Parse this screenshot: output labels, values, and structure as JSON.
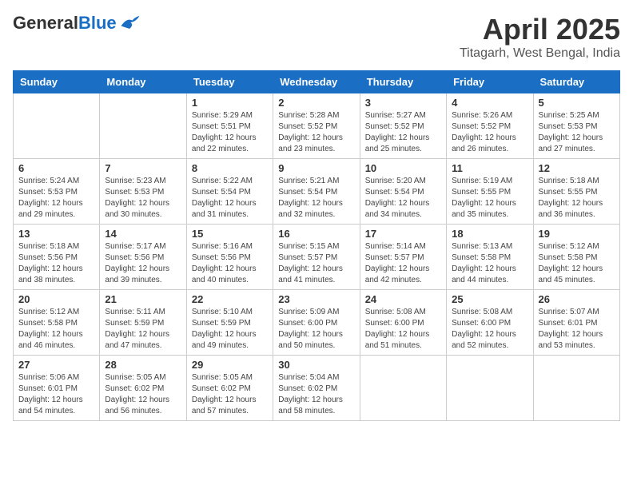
{
  "header": {
    "logo_general": "General",
    "logo_blue": "Blue",
    "title": "April 2025",
    "subtitle": "Titagarh, West Bengal, India"
  },
  "weekdays": [
    "Sunday",
    "Monday",
    "Tuesday",
    "Wednesday",
    "Thursday",
    "Friday",
    "Saturday"
  ],
  "weeks": [
    [
      {
        "day": "",
        "info": ""
      },
      {
        "day": "",
        "info": ""
      },
      {
        "day": "1",
        "info": "Sunrise: 5:29 AM\nSunset: 5:51 PM\nDaylight: 12 hours and 22 minutes."
      },
      {
        "day": "2",
        "info": "Sunrise: 5:28 AM\nSunset: 5:52 PM\nDaylight: 12 hours and 23 minutes."
      },
      {
        "day": "3",
        "info": "Sunrise: 5:27 AM\nSunset: 5:52 PM\nDaylight: 12 hours and 25 minutes."
      },
      {
        "day": "4",
        "info": "Sunrise: 5:26 AM\nSunset: 5:52 PM\nDaylight: 12 hours and 26 minutes."
      },
      {
        "day": "5",
        "info": "Sunrise: 5:25 AM\nSunset: 5:53 PM\nDaylight: 12 hours and 27 minutes."
      }
    ],
    [
      {
        "day": "6",
        "info": "Sunrise: 5:24 AM\nSunset: 5:53 PM\nDaylight: 12 hours and 29 minutes."
      },
      {
        "day": "7",
        "info": "Sunrise: 5:23 AM\nSunset: 5:53 PM\nDaylight: 12 hours and 30 minutes."
      },
      {
        "day": "8",
        "info": "Sunrise: 5:22 AM\nSunset: 5:54 PM\nDaylight: 12 hours and 31 minutes."
      },
      {
        "day": "9",
        "info": "Sunrise: 5:21 AM\nSunset: 5:54 PM\nDaylight: 12 hours and 32 minutes."
      },
      {
        "day": "10",
        "info": "Sunrise: 5:20 AM\nSunset: 5:54 PM\nDaylight: 12 hours and 34 minutes."
      },
      {
        "day": "11",
        "info": "Sunrise: 5:19 AM\nSunset: 5:55 PM\nDaylight: 12 hours and 35 minutes."
      },
      {
        "day": "12",
        "info": "Sunrise: 5:18 AM\nSunset: 5:55 PM\nDaylight: 12 hours and 36 minutes."
      }
    ],
    [
      {
        "day": "13",
        "info": "Sunrise: 5:18 AM\nSunset: 5:56 PM\nDaylight: 12 hours and 38 minutes."
      },
      {
        "day": "14",
        "info": "Sunrise: 5:17 AM\nSunset: 5:56 PM\nDaylight: 12 hours and 39 minutes."
      },
      {
        "day": "15",
        "info": "Sunrise: 5:16 AM\nSunset: 5:56 PM\nDaylight: 12 hours and 40 minutes."
      },
      {
        "day": "16",
        "info": "Sunrise: 5:15 AM\nSunset: 5:57 PM\nDaylight: 12 hours and 41 minutes."
      },
      {
        "day": "17",
        "info": "Sunrise: 5:14 AM\nSunset: 5:57 PM\nDaylight: 12 hours and 42 minutes."
      },
      {
        "day": "18",
        "info": "Sunrise: 5:13 AM\nSunset: 5:58 PM\nDaylight: 12 hours and 44 minutes."
      },
      {
        "day": "19",
        "info": "Sunrise: 5:12 AM\nSunset: 5:58 PM\nDaylight: 12 hours and 45 minutes."
      }
    ],
    [
      {
        "day": "20",
        "info": "Sunrise: 5:12 AM\nSunset: 5:58 PM\nDaylight: 12 hours and 46 minutes."
      },
      {
        "day": "21",
        "info": "Sunrise: 5:11 AM\nSunset: 5:59 PM\nDaylight: 12 hours and 47 minutes."
      },
      {
        "day": "22",
        "info": "Sunrise: 5:10 AM\nSunset: 5:59 PM\nDaylight: 12 hours and 49 minutes."
      },
      {
        "day": "23",
        "info": "Sunrise: 5:09 AM\nSunset: 6:00 PM\nDaylight: 12 hours and 50 minutes."
      },
      {
        "day": "24",
        "info": "Sunrise: 5:08 AM\nSunset: 6:00 PM\nDaylight: 12 hours and 51 minutes."
      },
      {
        "day": "25",
        "info": "Sunrise: 5:08 AM\nSunset: 6:00 PM\nDaylight: 12 hours and 52 minutes."
      },
      {
        "day": "26",
        "info": "Sunrise: 5:07 AM\nSunset: 6:01 PM\nDaylight: 12 hours and 53 minutes."
      }
    ],
    [
      {
        "day": "27",
        "info": "Sunrise: 5:06 AM\nSunset: 6:01 PM\nDaylight: 12 hours and 54 minutes."
      },
      {
        "day": "28",
        "info": "Sunrise: 5:05 AM\nSunset: 6:02 PM\nDaylight: 12 hours and 56 minutes."
      },
      {
        "day": "29",
        "info": "Sunrise: 5:05 AM\nSunset: 6:02 PM\nDaylight: 12 hours and 57 minutes."
      },
      {
        "day": "30",
        "info": "Sunrise: 5:04 AM\nSunset: 6:02 PM\nDaylight: 12 hours and 58 minutes."
      },
      {
        "day": "",
        "info": ""
      },
      {
        "day": "",
        "info": ""
      },
      {
        "day": "",
        "info": ""
      }
    ]
  ]
}
